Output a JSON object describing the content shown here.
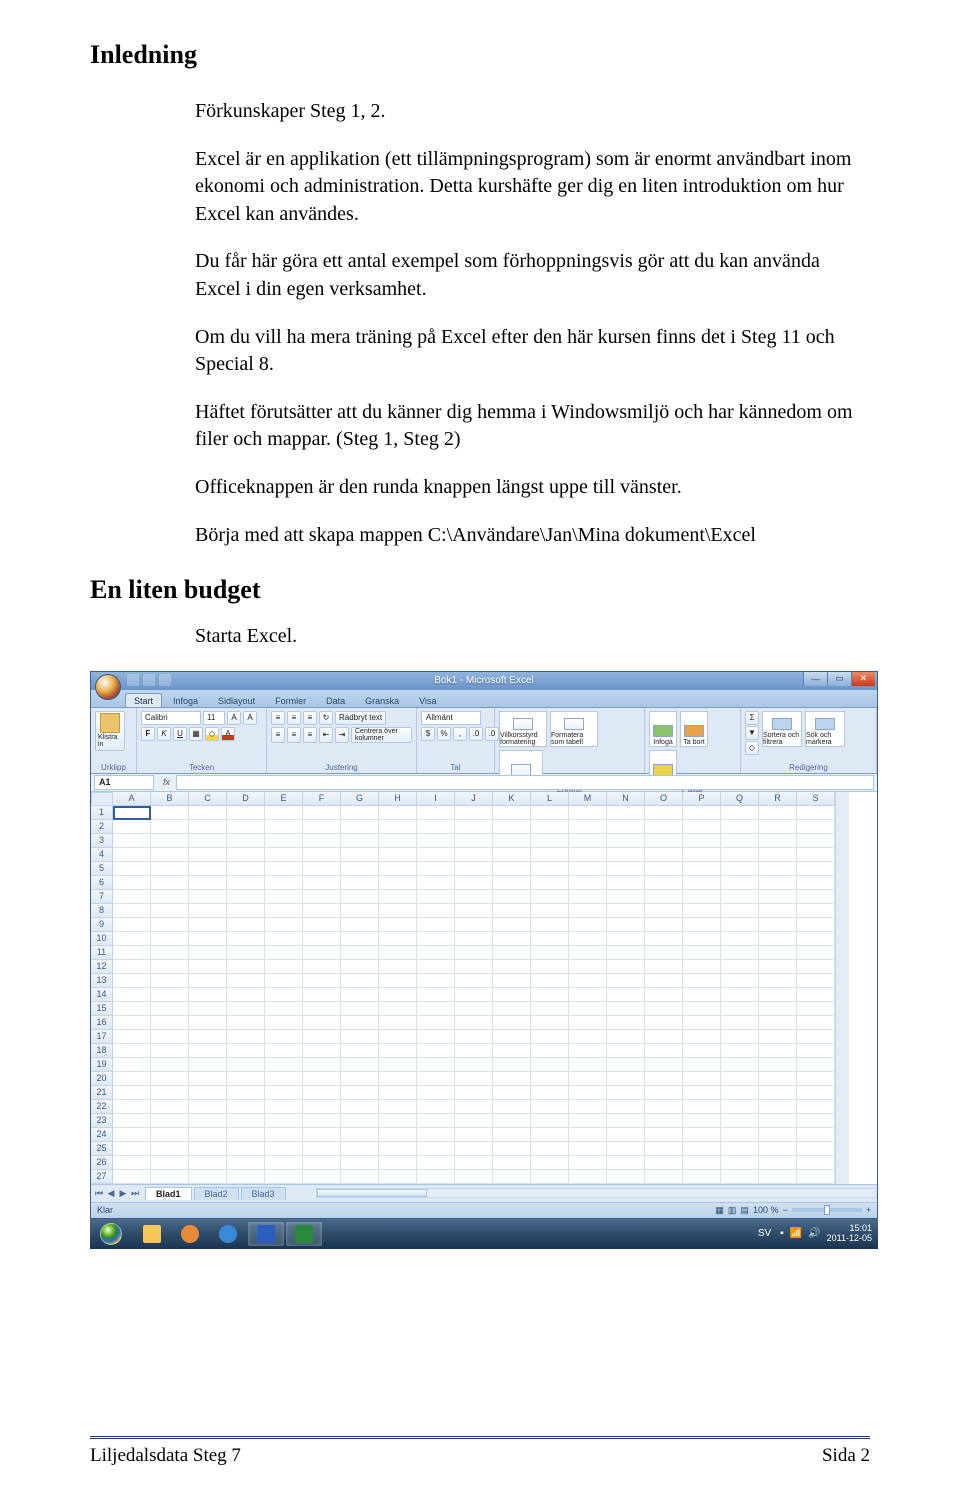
{
  "headings": {
    "inledning": "Inledning",
    "en_liten_budget": "En liten budget"
  },
  "paragraphs": {
    "p1": "Förkunskaper Steg 1, 2.",
    "p2": "Excel är en applikation (ett tillämpningsprogram) som är enormt användbart inom ekonomi och administration. Detta kurshäfte ger dig en liten introduktion om hur Excel kan användes.",
    "p3": "Du får här göra ett antal exempel som förhoppningsvis gör att du kan använda Excel i din egen verksamhet.",
    "p4": "Om du vill ha mera träning på Excel efter den här kursen finns det i Steg 11 och Special 8.",
    "p5": "Häftet förutsätter att du känner dig hemma i Windowsmiljö och har kännedom om filer och mappar. (Steg 1, Steg 2)",
    "p6": "Officeknappen är den runda knappen längst uppe till vänster.",
    "p7": "Börja med att skapa mappen C:\\Användare\\Jan\\Mina dokument\\Excel",
    "p8": "Starta Excel."
  },
  "excel": {
    "title": "Bok1 - Microsoft Excel",
    "tabs": [
      "Start",
      "Infoga",
      "Sidlayout",
      "Formler",
      "Data",
      "Granska",
      "Visa"
    ],
    "active_tab": "Start",
    "groups": {
      "urklipp": "Urklipp",
      "tecken": "Tecken",
      "justering": "Justering",
      "tal": "Tal",
      "format": "Format",
      "celler": "Celler",
      "redigering": "Redigering"
    },
    "clipboard_btn": "Klistra in",
    "font_name": "Calibri",
    "font_size": "11",
    "wrap_text": "Radbryt text",
    "merge_center": "Centrera över kolumner",
    "number_format": "Allmänt",
    "styles": {
      "conditional": "Villkorsstyrd formatering",
      "as_table": "Formatera som tabell",
      "cell_style": "Cellformat"
    },
    "cells": {
      "insert": "Infoga",
      "delete": "Ta bort",
      "format": "Format"
    },
    "editing": {
      "sort": "Sortera och filtrera",
      "find": "Sök och markera"
    },
    "namebox": "A1",
    "fx": "fx",
    "columns": [
      "A",
      "B",
      "C",
      "D",
      "E",
      "F",
      "G",
      "H",
      "I",
      "J",
      "K",
      "L",
      "M",
      "N",
      "O",
      "P",
      "Q",
      "R",
      "S"
    ],
    "row_count": 27,
    "sheets": [
      "Blad1",
      "Blad2",
      "Blad3"
    ],
    "status": "Klar",
    "zoom": "100 %"
  },
  "taskbar": {
    "lang": "SV",
    "time": "15:01",
    "date": "2011-12-05"
  },
  "footer": {
    "left": "Liljedalsdata Steg 7",
    "right": "Sida 2"
  }
}
